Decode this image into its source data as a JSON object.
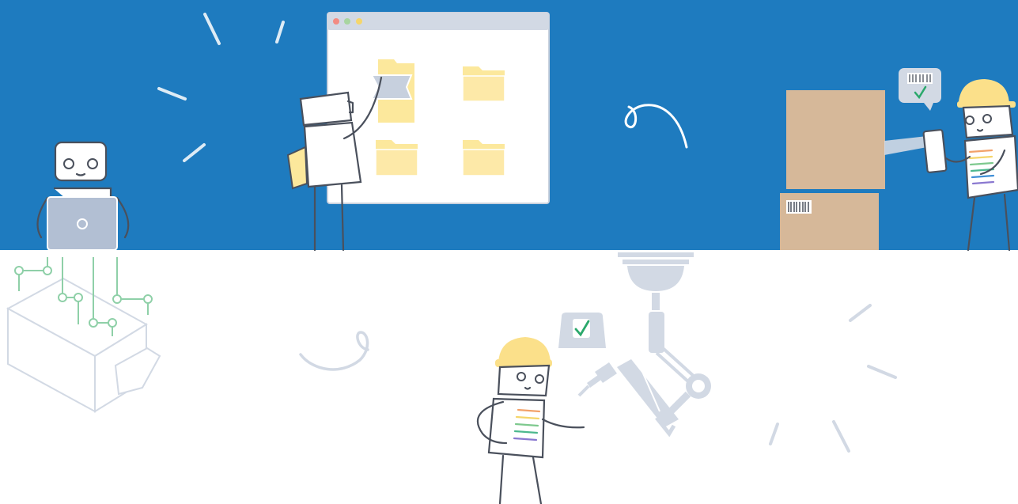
{
  "colors": {
    "top_band": "#1e7bbf",
    "bottom_band": "#ffffff",
    "folder": "#fce89c",
    "box": "#d6b899",
    "hard_hat": "#fbe08a",
    "robot_gray": "#d2d9e4",
    "circuit": "#8fd0a8",
    "accent_white": "#ffffff"
  },
  "scenes": {
    "top": [
      "robot-at-laptop",
      "robot-organizing-folders",
      "robot-scanning-boxes"
    ],
    "bottom": [
      "circuit-board-chip",
      "robot-inspector-with-checklist",
      "industrial-robot-arm"
    ]
  },
  "icons": {
    "window_controls": [
      "close-dot-icon",
      "minimize-dot-icon",
      "maximize-dot-icon"
    ],
    "checkmark": "checkmark-icon",
    "barcode": "barcode-icon",
    "folder": "folder-icon"
  }
}
